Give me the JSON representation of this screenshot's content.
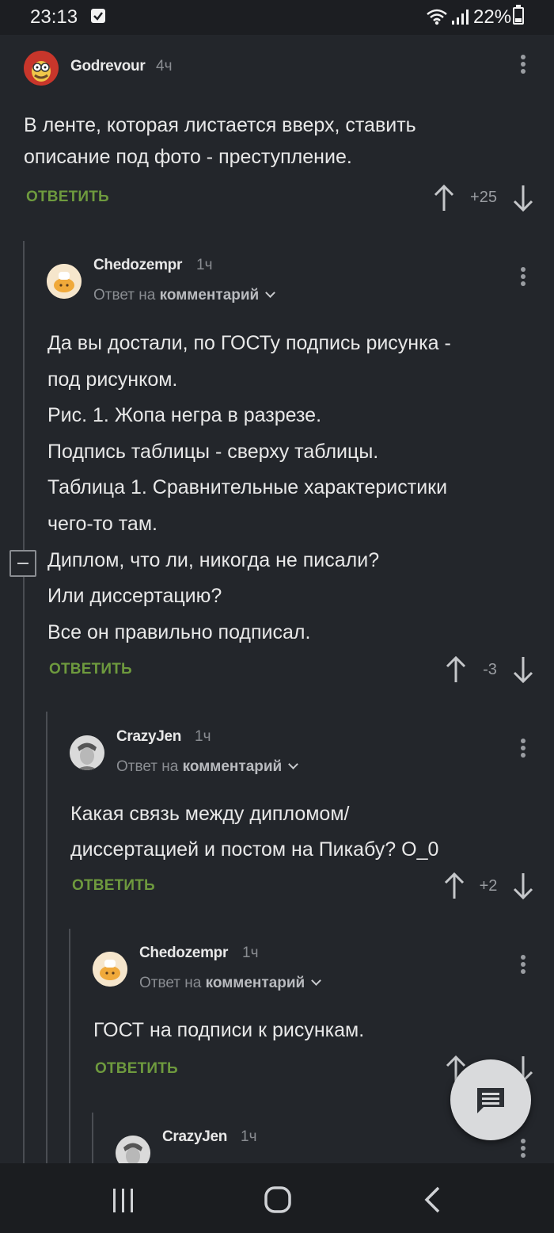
{
  "status_bar": {
    "time": "23:13",
    "battery": "22%"
  },
  "reply_label": "ОТВЕТИТЬ",
  "reply_to_prefix": "Ответ на",
  "reply_to_link": "комментарий",
  "comments": [
    {
      "author": "Godrevour",
      "age": "4ч",
      "lines": [
        "В ленте, которая листается вверх, ставить",
        "описание под фото - преступление."
      ],
      "rating": "+25"
    },
    {
      "author": "Chedozempr",
      "age": "1ч",
      "lines": [
        "Да вы достали, по ГОСТу подпись рисунка -",
        "под рисунком.",
        "Рис. 1. Жопа негра в разрезе.",
        "Подпись таблицы - сверху таблицы.",
        "Таблица 1. Сравнительные характеристики",
        "чего-то там.",
        "Диплом, что ли, никогда не писали?",
        "Или диссертацию?",
        "Все он правильно подписал."
      ],
      "rating": "-3"
    },
    {
      "author": "CrazyJen",
      "age": "1ч",
      "lines": [
        "Какая связь между дипломом/",
        "диссертацией и постом на Пикабу? О_0"
      ],
      "rating": "+2"
    },
    {
      "author": "Chedozempr",
      "age": "1ч",
      "lines": [
        "ГОСТ на подписи к рисункам."
      ]
    },
    {
      "author": "CrazyJen",
      "age": "1ч"
    }
  ],
  "icons": {
    "status": [
      "checkbox-notification-icon",
      "wifi-icon",
      "signal-icon",
      "battery-icon"
    ],
    "comment": [
      "avatar",
      "more-icon",
      "chevron-down-icon",
      "upvote-icon",
      "downvote-icon"
    ],
    "fab": "comment-icon",
    "nav": [
      "recent-apps-icon",
      "home-icon",
      "back-icon"
    ]
  },
  "colors": {
    "background": "#23262b",
    "reply_green": "#6e9a3e",
    "text": "#e8e8e8",
    "muted": "#8a8d92"
  }
}
